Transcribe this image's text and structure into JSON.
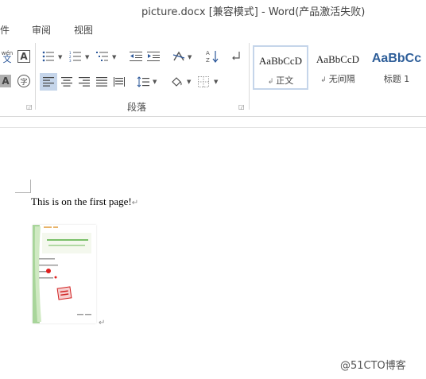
{
  "window": {
    "title": "picture.docx [兼容模式] - Word(产品激活失败)"
  },
  "menu": {
    "tabs": [
      {
        "label": "件"
      },
      {
        "label": "审阅"
      },
      {
        "label": "视图"
      }
    ]
  },
  "ribbon": {
    "phonetic_glyph": "wén",
    "phonetic_char": "文",
    "border_char": "A",
    "shading_char": "A",
    "enclose_char": "字",
    "paragraph_group_label": "段落",
    "styles": [
      {
        "sample": "AaBbCcD",
        "name": "正文",
        "selected": true
      },
      {
        "sample": "AaBbCcD",
        "name": "无间隔",
        "selected": false
      },
      {
        "sample": "AaBbCc",
        "name": "标题 1",
        "selected": false,
        "color": "#2e5e99"
      }
    ]
  },
  "document": {
    "paragraph_text": "This is on the first page!",
    "paragraph_mark": "↵",
    "picture_mark": "↵",
    "picture": {
      "header_text": "专项资格证书考试报名登记表",
      "stamp_text": "已审核"
    }
  },
  "watermark": {
    "text": "@51CTO博客"
  },
  "colors": {
    "accent": "#2b579a",
    "selected_style_border": "#c5d5ea",
    "active_align": "#c5d5ea"
  }
}
